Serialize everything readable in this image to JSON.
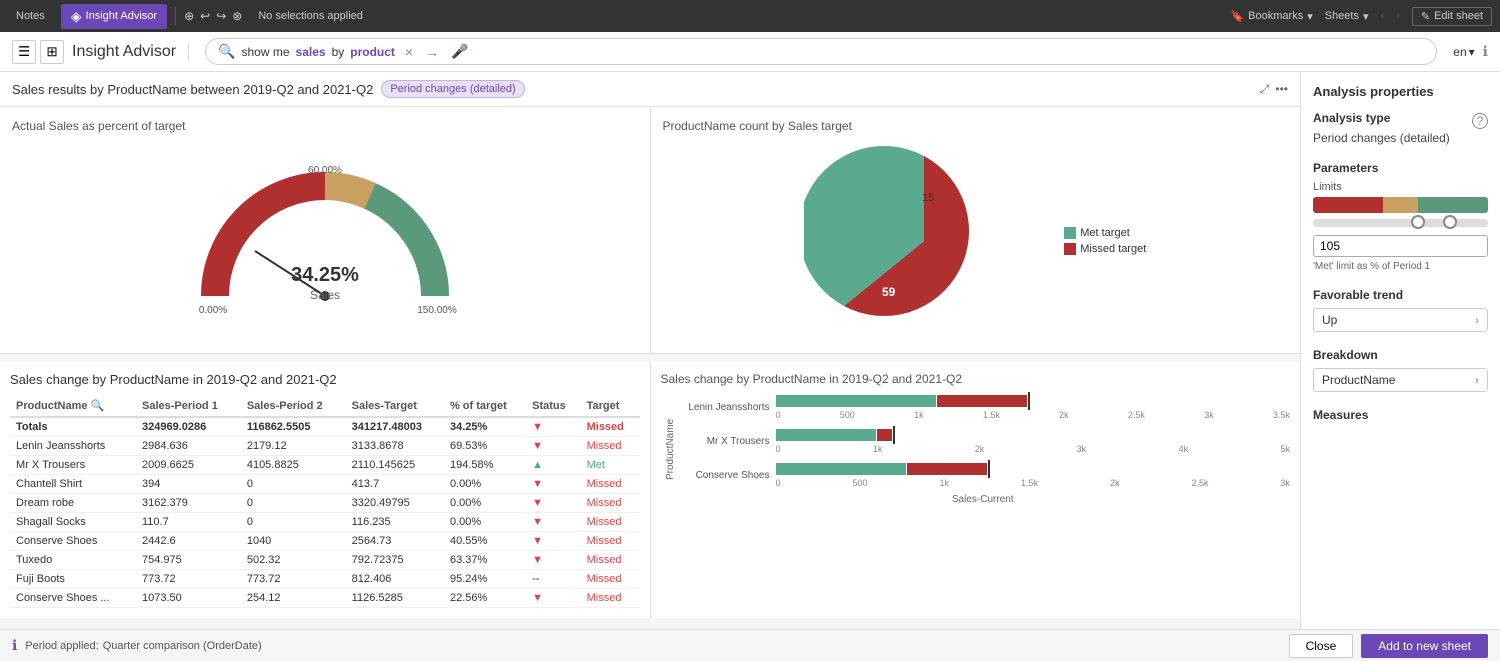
{
  "topbar": {
    "notes_label": "Notes",
    "insight_advisor_label": "Insight Advisor",
    "no_selections": "No selections applied",
    "bookmarks_label": "Bookmarks",
    "sheets_label": "Sheets",
    "edit_sheet_label": "Edit sheet"
  },
  "secondbar": {
    "title": "Insight Advisor",
    "search_text_prefix": "show me ",
    "search_keyword": "sales",
    "search_text_mid": " by ",
    "search_keyword2": "product",
    "lang": "en",
    "clear_label": "×",
    "arrow_label": "→"
  },
  "results": {
    "header_title": "Sales results by ProductName between 2019-Q2 and 2021-Q2",
    "badge_label": "Period changes (detailed)",
    "gauge_title": "Actual Sales as percent of target",
    "gauge_center_value": "34.25%",
    "gauge_center_label": "Sales",
    "gauge_min": "0.00%",
    "gauge_max": "150.00%",
    "gauge_top": "60.00%",
    "pie_title": "ProductName count by Sales target",
    "pie_met_label": "Met target",
    "pie_met_value": "15",
    "pie_missed_label": "Missed target",
    "pie_missed_value": "59",
    "table_title_left": "Sales change by ProductName in 2019-Q2 and 2021-Q2",
    "table_title_right": "Sales change by ProductName in 2019-Q2 and 2021-Q2",
    "table_cols": [
      "ProductName",
      "Sales-Period 1",
      "Sales-Period 2",
      "Sales-Target",
      "% of target",
      "Status",
      "Target"
    ],
    "table_rows": [
      {
        "name": "Totals",
        "p1": "324969.0286",
        "p2": "116862.5505",
        "target": "341217.48003",
        "pct": "34.25%",
        "trend": "▼",
        "status": "Missed",
        "bold": true
      },
      {
        "name": "Lenin Jeansshorts",
        "p1": "2984.636",
        "p2": "2179.12",
        "target": "3133.8678",
        "pct": "69.53%",
        "trend": "▼",
        "status": "Missed",
        "bold": false
      },
      {
        "name": "Mr X Trousers",
        "p1": "2009.6625",
        "p2": "4105.8825",
        "target": "2110.145625",
        "pct": "194.58%",
        "trend": "▲",
        "status": "Met",
        "bold": false
      },
      {
        "name": "Chantell Shirt",
        "p1": "394",
        "p2": "0",
        "target": "413.7",
        "pct": "0.00%",
        "trend": "▼",
        "status": "Missed",
        "bold": false
      },
      {
        "name": "Dream robe",
        "p1": "3162.379",
        "p2": "0",
        "target": "3320.49795",
        "pct": "0.00%",
        "trend": "▼",
        "status": "Missed",
        "bold": false
      },
      {
        "name": "Shagall Socks",
        "p1": "110.7",
        "p2": "0",
        "target": "116.235",
        "pct": "0.00%",
        "trend": "▼",
        "status": "Missed",
        "bold": false
      },
      {
        "name": "Conserve Shoes",
        "p1": "2442.6",
        "p2": "1040",
        "target": "2564.73",
        "pct": "40.55%",
        "trend": "▼",
        "status": "Missed",
        "bold": false
      },
      {
        "name": "Tuxedo",
        "p1": "754.975",
        "p2": "502.32",
        "target": "792.72375",
        "pct": "63.37%",
        "trend": "▼",
        "status": "Missed",
        "bold": false
      },
      {
        "name": "Fuji Boots",
        "p1": "773.72",
        "p2": "773.72",
        "target": "812.406",
        "pct": "95.24%",
        "trend": "--",
        "status": "Missed",
        "bold": false
      },
      {
        "name": "Conserve Shoes ...",
        "p1": "1073.50",
        "p2": "254.12",
        "target": "1126.5285",
        "pct": "22.56%",
        "trend": "▼",
        "status": "Missed",
        "bold": false
      }
    ],
    "bar_chart_items": [
      {
        "label": "Lenin Jeansshorts",
        "teal_w": 45,
        "red_w": 50,
        "marker": 42,
        "axis_max": "3.5k"
      },
      {
        "label": "Mr X Trousers",
        "teal_w": 35,
        "red_w": 5,
        "marker": 38,
        "axis_max": "5k"
      },
      {
        "label": "Conserve Shoes",
        "teal_w": 40,
        "red_w": 35,
        "marker": 45,
        "axis_max": "3k"
      }
    ],
    "bar_x_axis": [
      "0",
      "500",
      "1k",
      "1.5k",
      "2k",
      "2.5k",
      "3k",
      "3.5k"
    ],
    "bar_xlabel": "Sales-Current"
  },
  "right_panel": {
    "heading": "Analysis properties",
    "analysis_type_label": "Analysis type",
    "analysis_type_value": "Period changes (detailed)",
    "parameters_label": "Parameters",
    "limits_label": "Limits",
    "limits_input_value": "105",
    "limits_hint": "'Met' limit as % of Period 1",
    "favorable_trend_label": "Favorable trend",
    "favorable_value": "Up",
    "breakdown_label": "Breakdown",
    "breakdown_value": "ProductName",
    "measures_label": "Measures",
    "help_icon": "?"
  },
  "bottom": {
    "period_label": "Period applied:",
    "period_value": "Quarter comparison (OrderDate)",
    "close_label": "Close",
    "add_label": "Add to new sheet"
  }
}
